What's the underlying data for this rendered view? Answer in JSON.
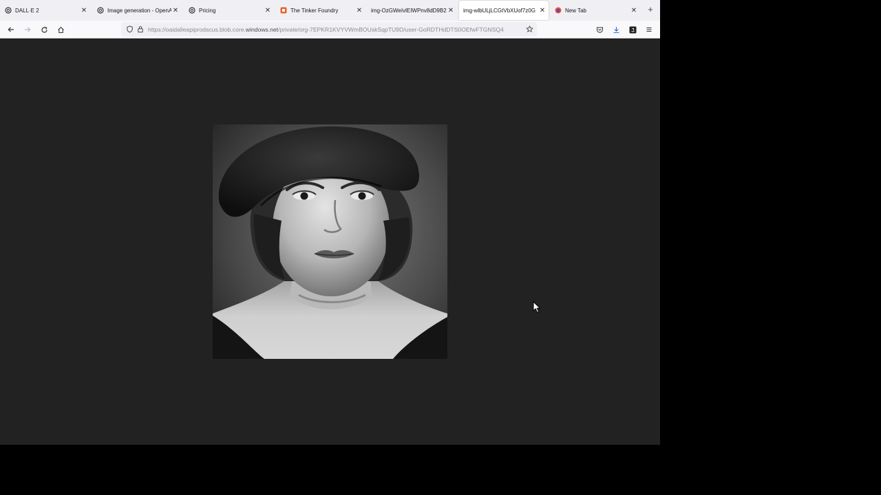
{
  "tabs": [
    {
      "title": "DALL·E 2",
      "icon": "openai-icon",
      "active": false
    },
    {
      "title": "Image generation - OpenAI",
      "icon": "openai-icon",
      "active": false
    },
    {
      "title": "Pricing",
      "icon": "openai-icon",
      "active": false
    },
    {
      "title": "The Tinker Foundry",
      "icon": "brand-icon",
      "active": false
    },
    {
      "title": "img-OzGWeIvlEIWPnv8dD9B2",
      "icon": "",
      "active": false
    },
    {
      "title": "img-wlbULjLCGtVbXUof7z0G",
      "icon": "",
      "active": true
    },
    {
      "title": "New Tab",
      "icon": "firefox-icon",
      "active": false
    }
  ],
  "address_bar": {
    "url_prefix": "https://oaidalleapiprodscus.blob.core.",
    "url_host": "windows.net",
    "url_suffix": "/private/org-7EPKR1KVYVWmBOUskSqpTU9D/user-GoRDTHdDTS0OEfwFTGNSQ4"
  },
  "image": {
    "description_icon": "portrait-image"
  },
  "colors": {
    "page_background": "#222222",
    "tabstrip": "#f0f0f4",
    "toolbar": "#f9f9fb"
  }
}
